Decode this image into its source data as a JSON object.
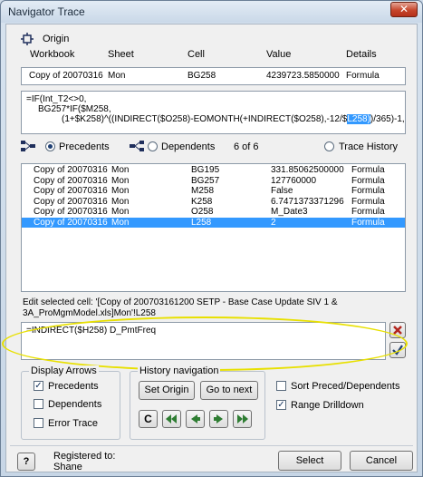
{
  "window": {
    "title": "Navigator Trace",
    "close_glyph": "✕"
  },
  "origin": {
    "label": "Origin",
    "headers": {
      "workbook": "Workbook",
      "sheet": "Sheet",
      "cell": "Cell",
      "value": "Value",
      "details": "Details"
    },
    "row": {
      "workbook": "Copy of 20070316",
      "sheet": "Mon",
      "cell": "BG258",
      "value": "4239723.5850000",
      "details": "Formula"
    }
  },
  "formula": {
    "line1": "=IF(Int_T2<>0,",
    "line2": "BG257*IF($M258,",
    "line3_before": "(1+$K258)^((INDIRECT($O258)-EOMONTH(+INDIRECT($O258),-12/$",
    "line3_highlight": "L258)",
    "line3_after": ")/365)-1,"
  },
  "trace": {
    "precedents_label": "Precedents",
    "dependents_label": "Dependents",
    "count_label": "6 of 6",
    "history_label": "Trace History",
    "mode": "precedents"
  },
  "results": [
    {
      "workbook": "Copy of 20070316",
      "sheet": "Mon",
      "cell": "BG195",
      "value": "331.85062500000",
      "details": "Formula",
      "selected": false
    },
    {
      "workbook": "Copy of 20070316",
      "sheet": "Mon",
      "cell": "BG257",
      "value": "127760000",
      "details": "Formula",
      "selected": false
    },
    {
      "workbook": "Copy of 20070316",
      "sheet": "Mon",
      "cell": "M258",
      "value": "False",
      "details": "Formula",
      "selected": false
    },
    {
      "workbook": "Copy of 20070316",
      "sheet": "Mon",
      "cell": "K258",
      "value": "6.7471373371296",
      "details": "Formula",
      "selected": false
    },
    {
      "workbook": "Copy of 20070316",
      "sheet": "Mon",
      "cell": "O258",
      "value": "M_Date3",
      "details": "Formula",
      "selected": false
    },
    {
      "workbook": "Copy of 20070316",
      "sheet": "Mon",
      "cell": "L258",
      "value": "2",
      "details": "Formula",
      "selected": true
    }
  ],
  "edit": {
    "label_line1": "Edit selected cell: '[Copy of 200703161200 SETP - Base Case Update SIV 1 &",
    "label_line2": "3A_ProMgmModel.xls]Mon'!L258",
    "value": "=INDIRECT($H258) D_PmtFreq"
  },
  "display_arrows": {
    "legend": "Display Arrows",
    "precedents": {
      "label": "Precedents",
      "checked": true
    },
    "dependents": {
      "label": "Dependents",
      "checked": false
    },
    "error_trace": {
      "label": "Error Trace",
      "checked": false
    }
  },
  "history": {
    "legend": "History navigation",
    "set_origin": "Set Origin",
    "go_to_next": "Go to next",
    "clear": "C"
  },
  "options": {
    "sort": {
      "label": "Sort Preced/Dependents",
      "checked": false
    },
    "drilldown": {
      "label": "Range Drilldown",
      "checked": true
    }
  },
  "footer": {
    "help": "?",
    "registered_to": "Registered to:",
    "user": "Shane",
    "select": "Select",
    "cancel": "Cancel"
  },
  "colors": {
    "selection": "#3399ff",
    "nav_arrow": "#2e7d32",
    "close": "#c6462c",
    "annotation": "#e8e000"
  }
}
